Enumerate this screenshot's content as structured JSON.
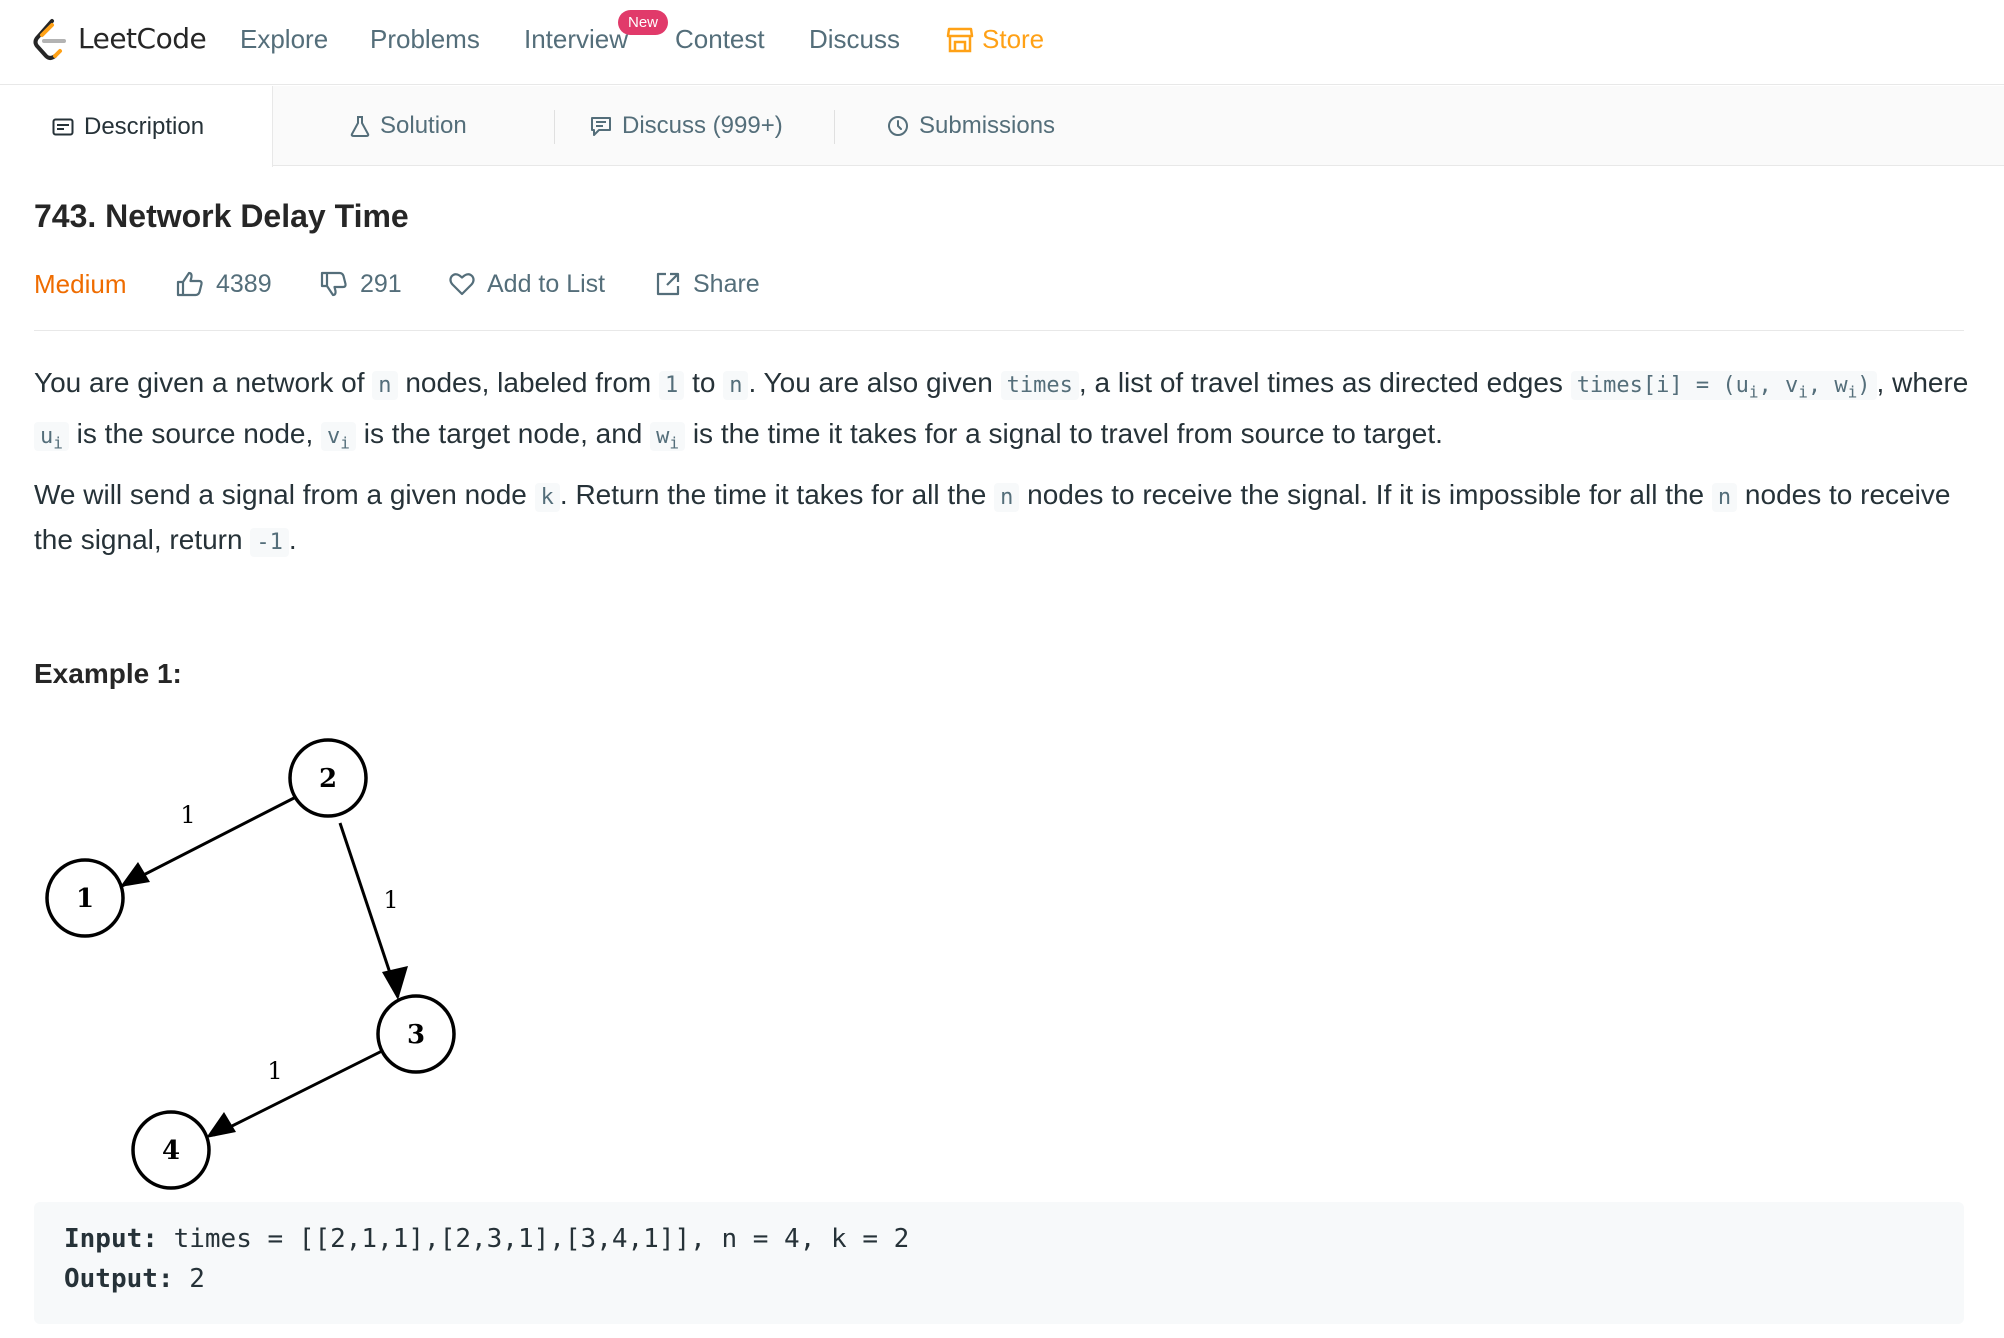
{
  "nav": {
    "logo_text": "LeetCode",
    "items": [
      "Explore",
      "Problems",
      "Interview",
      "Contest",
      "Discuss"
    ],
    "new_badge": "New",
    "store": "Store"
  },
  "tabs": {
    "description": "Description",
    "solution": "Solution",
    "discuss": "Discuss (999+)",
    "submissions": "Submissions"
  },
  "problem": {
    "title": "743. Network Delay Time",
    "difficulty": "Medium",
    "likes": "4389",
    "dislikes": "291",
    "add_to_list": "Add to List",
    "share": "Share"
  },
  "description": {
    "p1": {
      "t1": "You are given a network of ",
      "c1": "n",
      "t2": " nodes, labeled from ",
      "c2": "1",
      "t3": " to ",
      "c3": "n",
      "t4": ". You are also given ",
      "c4": "times",
      "t5": ", a list of travel times as directed edges ",
      "c5a": "times[i] = (u",
      "c5s1": "i",
      "c5b": ", v",
      "c5s2": "i",
      "c5c": ", w",
      "c5s3": "i",
      "c5d": ")",
      "t6": ", where ",
      "c6": "u",
      "c6s": "i",
      "t7": " is the source node, ",
      "c7": "v",
      "c7s": "i",
      "t8": " is the target node, and ",
      "c8": "w",
      "c8s": "i",
      "t9": " is the time it takes for a signal to travel from source to target."
    },
    "p2": {
      "t1": "We will send a signal from a given node ",
      "c1": "k",
      "t2": ". Return the time it takes for all the ",
      "c2": "n",
      "t3": " nodes to receive the signal. If it is impossible for all the ",
      "c3": "n",
      "t4": " nodes to receive the signal, return ",
      "c4": "-1",
      "t5": "."
    }
  },
  "example": {
    "title": "Example 1:",
    "graph": {
      "nodes": [
        "1",
        "2",
        "3",
        "4"
      ],
      "edges": [
        {
          "from": "2",
          "to": "1",
          "weight": "1"
        },
        {
          "from": "2",
          "to": "3",
          "weight": "1"
        },
        {
          "from": "3",
          "to": "4",
          "weight": "1"
        }
      ]
    },
    "input_label": "Input:",
    "input_value": " times = [[2,1,1],[2,3,1],[3,4,1]], n = 4, k = 2",
    "output_label": "Output:",
    "output_value": " 2"
  }
}
